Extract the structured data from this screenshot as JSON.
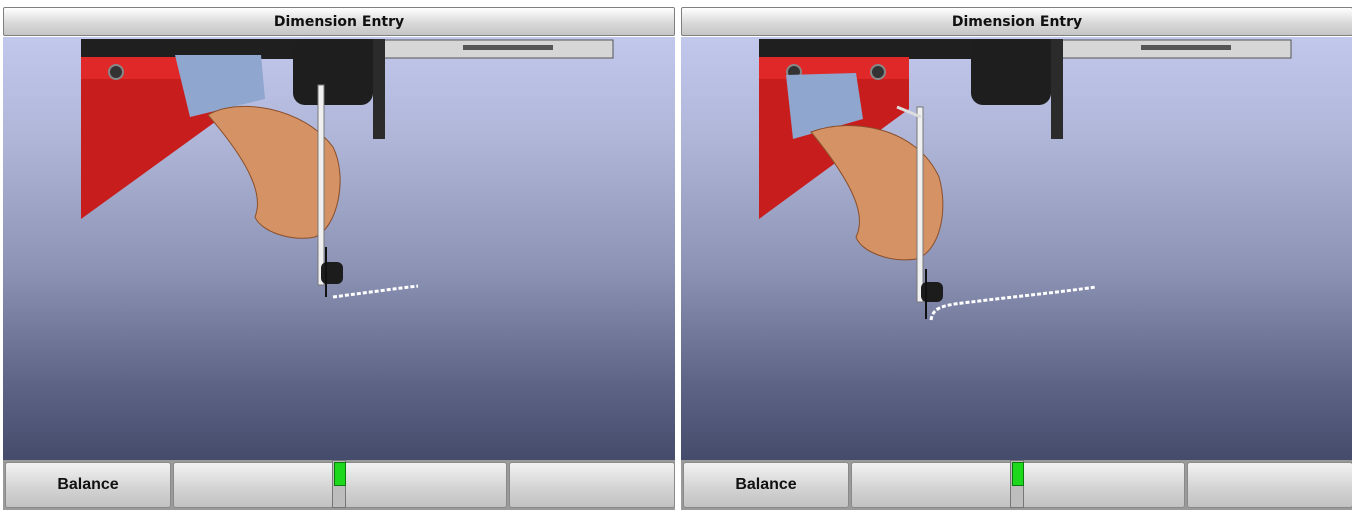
{
  "panels": [
    {
      "title": "Dimension Entry",
      "softkeys": [
        "Balance",
        "",
        "",
        ""
      ]
    },
    {
      "title": "Dimension Entry",
      "softkeys": [
        "Balance",
        "",
        "",
        ""
      ]
    }
  ],
  "colors": {
    "bg_top": "#c2c8ec",
    "bg_bottom": "#454b6b",
    "machine_red": "#c81d1d",
    "indicator_green": "#1ed81e"
  }
}
